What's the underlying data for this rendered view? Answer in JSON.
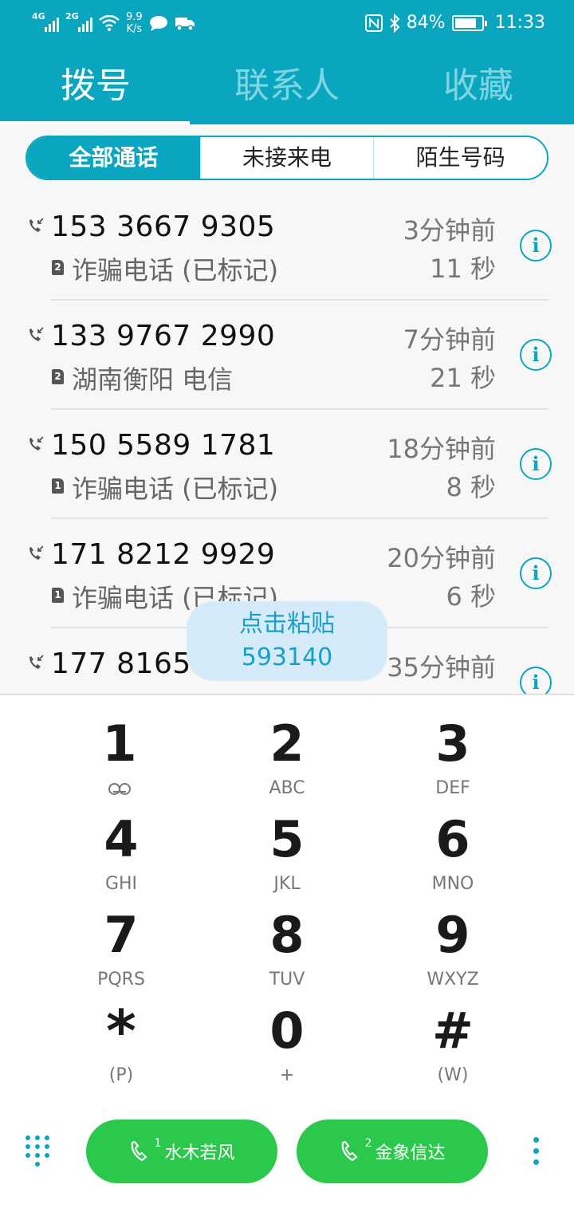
{
  "status": {
    "net1": "4G",
    "net2": "2G",
    "speed_value": "9.9",
    "speed_unit": "K/s",
    "battery": "84%",
    "battery_level": 0.84,
    "time": "11:33"
  },
  "tabs": [
    "拨号",
    "联系人",
    "收藏"
  ],
  "filters": [
    "全部通话",
    "未接来电",
    "陌生号码"
  ],
  "calls": [
    {
      "number": "153 3667 9305",
      "sim": "2",
      "label": "诈骗电话 (已标记)",
      "time": "3分钟前",
      "duration": "11 秒"
    },
    {
      "number": "133 9767 2990",
      "sim": "2",
      "label": "湖南衡阳 电信",
      "time": "7分钟前",
      "duration": "21 秒"
    },
    {
      "number": "150 5589 1781",
      "sim": "1",
      "label": "诈骗电话 (已标记)",
      "time": "18分钟前",
      "duration": "8 秒"
    },
    {
      "number": "171 8212 9929",
      "sim": "1",
      "label": "诈骗电话 (已标记)",
      "time": "20分钟前",
      "duration": "6 秒"
    },
    {
      "number": "177 8165 3",
      "sim": "2",
      "label": "",
      "time": "35分钟前",
      "duration": ""
    }
  ],
  "paste": {
    "title": "点击粘贴",
    "code": "593140"
  },
  "keys": [
    {
      "digit": "1",
      "letters": ""
    },
    {
      "digit": "2",
      "letters": "ABC"
    },
    {
      "digit": "3",
      "letters": "DEF"
    },
    {
      "digit": "4",
      "letters": "GHI"
    },
    {
      "digit": "5",
      "letters": "JKL"
    },
    {
      "digit": "6",
      "letters": "MNO"
    },
    {
      "digit": "7",
      "letters": "PQRS"
    },
    {
      "digit": "8",
      "letters": "TUV"
    },
    {
      "digit": "9",
      "letters": "WXYZ"
    },
    {
      "digit": "*",
      "letters": "(P)"
    },
    {
      "digit": "0",
      "letters": "+"
    },
    {
      "digit": "#",
      "letters": "(W)"
    }
  ],
  "call_buttons": [
    {
      "sim": "1",
      "label": "水木若风"
    },
    {
      "sim": "2",
      "label": "金象信达"
    }
  ],
  "colors": {
    "accent": "#0aa6c0",
    "call_green": "#2ac94b"
  }
}
